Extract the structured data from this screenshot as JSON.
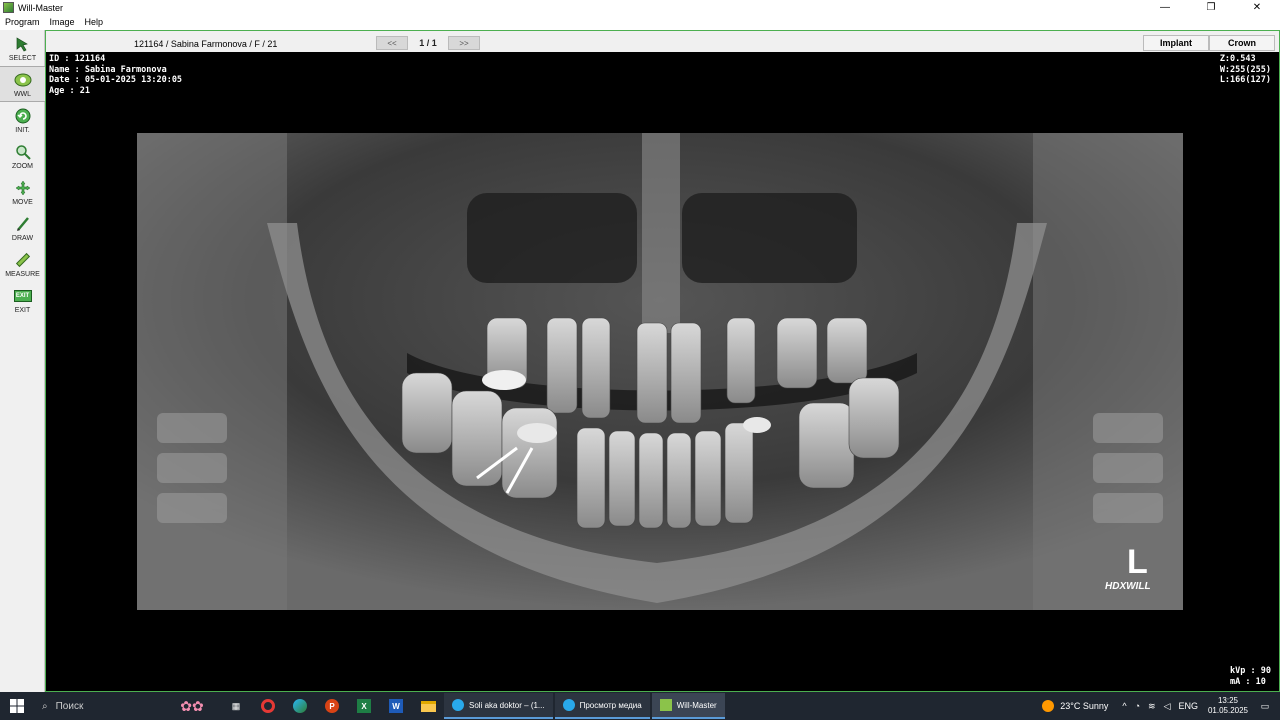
{
  "window": {
    "title": "Will-Master",
    "controls": [
      "—",
      "❐",
      "✕"
    ]
  },
  "menu": [
    "Program",
    "Image",
    "Help"
  ],
  "toolbar": [
    {
      "label": "SELECT",
      "icon": "select-arrow-icon"
    },
    {
      "label": "WWL",
      "icon": "wwl-icon",
      "active": true
    },
    {
      "label": "INIT.",
      "icon": "init-icon"
    },
    {
      "label": "ZOOM",
      "icon": "zoom-icon"
    },
    {
      "label": "MOVE",
      "icon": "move-icon"
    },
    {
      "label": "DRAW",
      "icon": "draw-icon"
    },
    {
      "label": "MEASURE",
      "icon": "measure-icon"
    },
    {
      "label": "EXIT",
      "icon": "exit-icon",
      "badge": "EXIT"
    }
  ],
  "header": {
    "patient": "121164 / Sabina Farmonova / F / 21",
    "prev": "<<",
    "page": "1 / 1",
    "next": ">>",
    "tabs": [
      "Implant",
      "Crown"
    ]
  },
  "overlay": {
    "id": "ID : 121164",
    "name": "Name : Sabina Farmonova",
    "date": "Date : 05-01-2025 13:20:05",
    "age": "Age : 21",
    "zoom": "Z:0.543",
    "width": "W:255(255)",
    "level": "L:166(127)",
    "kvp": "kVp : 90",
    "ma": "mA : 10"
  },
  "xray": {
    "marker": "L",
    "brand": "HDXWILL"
  },
  "taskbar": {
    "search": "Поиск",
    "apps": [
      {
        "label": "Soli aka doktor – (1..."
      },
      {
        "label": "Просмотр медиа"
      },
      {
        "label": "Will-Master",
        "active": true
      }
    ],
    "weather": "23°C  Sunny",
    "lang": "ENG",
    "time": "13:25",
    "date": "01.05.2025"
  }
}
